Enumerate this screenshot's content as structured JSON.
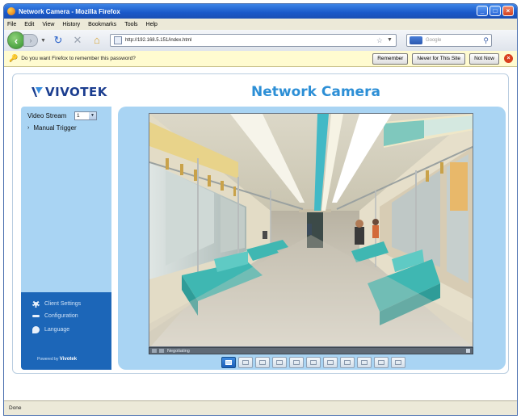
{
  "window": {
    "title": "Network Camera - Mozilla Firefox",
    "controls": [
      "minimize-icon",
      "maximize-icon",
      "close-icon"
    ]
  },
  "menubar": {
    "items": [
      "File",
      "Edit",
      "View",
      "History",
      "Bookmarks",
      "Tools",
      "Help"
    ]
  },
  "navbar": {
    "url": "http://192.168.5.151/index.html",
    "search_placeholder": "Google"
  },
  "password_bar": {
    "message": "Do you want Firefox to remember this password?",
    "remember": "Remember",
    "never": "Never for This Site",
    "not_now": "Not Now"
  },
  "page": {
    "brand": "VIVOTEK",
    "brand_tagline": "",
    "title": "Network Camera",
    "video_stream_label": "Video Stream",
    "video_stream_value": "1",
    "manual_trigger": "Manual Trigger",
    "settings": {
      "client": "Client Settings",
      "configuration": "Configuration",
      "language": "Language"
    },
    "powered_by": "Powered by",
    "powered_brand": "Vivotek",
    "video_status": "Negotiating",
    "toolbar_count": 11
  },
  "colors": {
    "accent": "#2d8fd6",
    "sidebar_light": "#a9d4f3",
    "sidebar_dark": "#1c66b8"
  },
  "statusbar": {
    "text": "Done"
  }
}
